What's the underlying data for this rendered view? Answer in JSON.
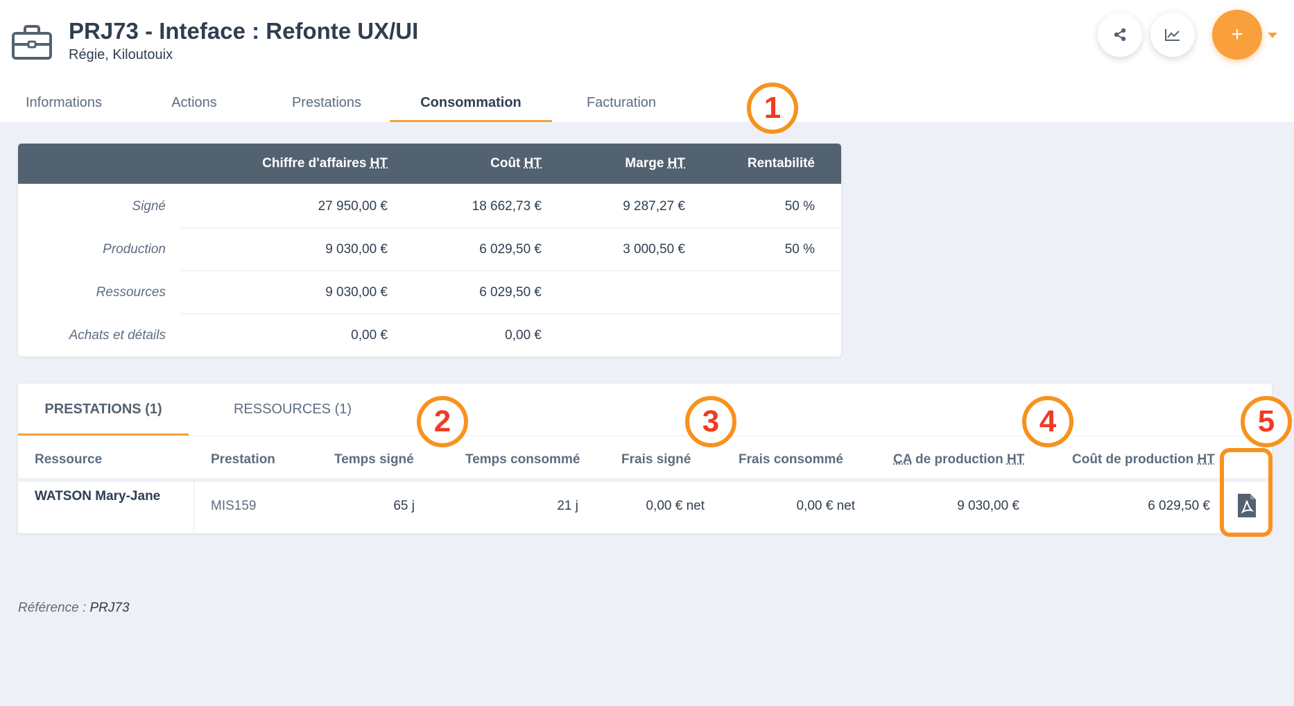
{
  "header": {
    "title": "PRJ73 - Inteface : Refonte UX/UI",
    "subtitle": "Régie, Kiloutouix",
    "project_icon": "briefcase-icon",
    "actions": {
      "share_icon": "share-icon",
      "chart_icon": "chart-line-icon",
      "add_label": "+",
      "add_menu_icon": "caret-down-icon"
    },
    "accent_color": "#f9a03c"
  },
  "tabs": [
    {
      "label": "Informations",
      "active": false
    },
    {
      "label": "Actions",
      "active": false
    },
    {
      "label": "Prestations",
      "active": false
    },
    {
      "label": "Consommation",
      "active": true
    },
    {
      "label": "Facturation",
      "active": false
    }
  ],
  "markers": [
    "1",
    "2",
    "3",
    "4",
    "5"
  ],
  "summary": {
    "columns": {
      "ca_prefix": "Chiffre d'affaires ",
      "cout_prefix": "Coût ",
      "marge_prefix": "Marge ",
      "ht": "HT",
      "rentabilite": "Rentabilité"
    },
    "rows": [
      {
        "label": "Signé",
        "ca": "27 950,00 €",
        "cout": "18 662,73 €",
        "marge": "9 287,27 €",
        "rentabilite": "50 %"
      },
      {
        "label": "Production",
        "ca": "9 030,00 €",
        "cout": "6 029,50 €",
        "marge": "3 000,50 €",
        "rentabilite": "50 %"
      },
      {
        "label": "Ressources",
        "ca": "9 030,00 €",
        "cout": "6 029,50 €",
        "marge": "",
        "rentabilite": ""
      },
      {
        "label": "Achats et détails",
        "ca": "0,00 €",
        "cout": "0,00 €",
        "marge": "",
        "rentabilite": ""
      }
    ]
  },
  "detail": {
    "tabs": [
      {
        "label": "PRESTATIONS (1)",
        "active": true
      },
      {
        "label": "RESSOURCES (1)",
        "active": false
      }
    ],
    "columns": {
      "ressource": "Ressource",
      "prestation": "Prestation",
      "temps_signe": "Temps signé",
      "temps_consomme": "Temps consommé",
      "frais_signe": "Frais signé",
      "frais_consomme": "Frais consommé",
      "ca_prefix": "CA",
      "ca_suffix": " de production ",
      "cout_prefix": "Coût de production ",
      "ht": "HT"
    },
    "rows": [
      {
        "ressource": "WATSON Mary-Jane",
        "prestation": "MIS159",
        "temps_signe": "65 j",
        "temps_consomme": "21 j",
        "frais_signe": "0,00 € net",
        "frais_consomme": "0,00 € net",
        "ca_production": "9 030,00 €",
        "cout_production": "6 029,50 €",
        "export_icon": "pdf-icon"
      }
    ]
  },
  "reference": {
    "label": "Référence : ",
    "value": "PRJ73"
  }
}
